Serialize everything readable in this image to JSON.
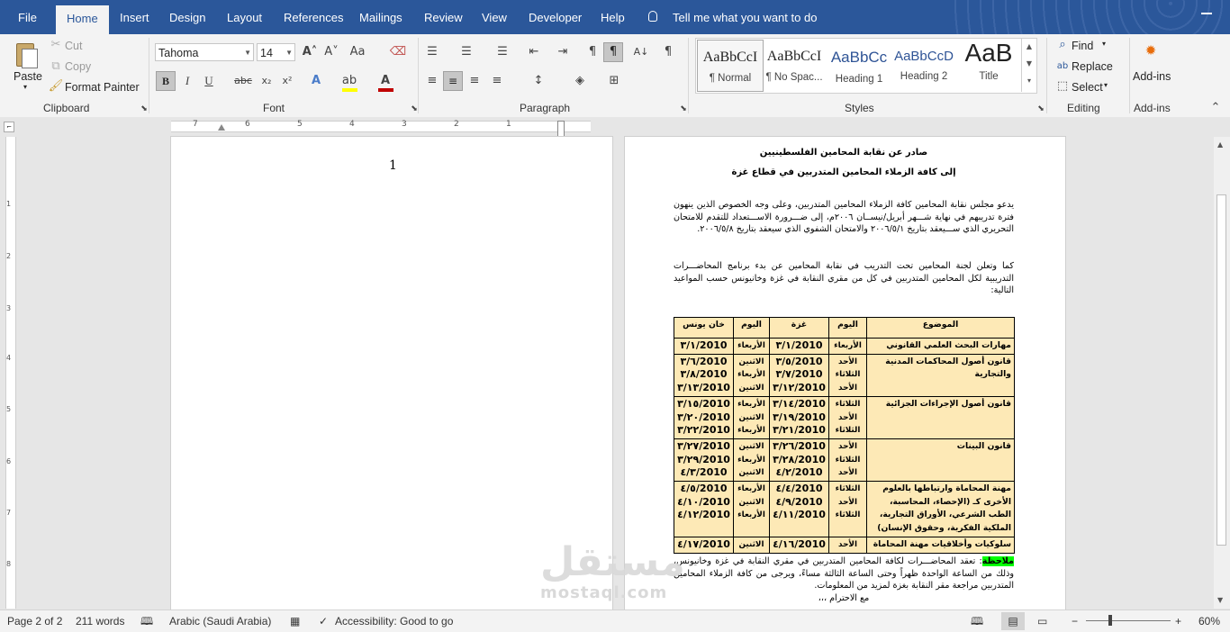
{
  "tabs": [
    "File",
    "Home",
    "Insert",
    "Design",
    "Layout",
    "References",
    "Mailings",
    "Review",
    "View",
    "Developer",
    "Help"
  ],
  "tell_me": "Tell me what you want to do",
  "clipboard": {
    "paste": "Paste",
    "cut": "Cut",
    "copy": "Copy",
    "format_painter": "Format Painter",
    "label": "Clipboard"
  },
  "font": {
    "name": "Tahoma",
    "size": "14",
    "label": "Font"
  },
  "paragraph": {
    "label": "Paragraph"
  },
  "styles": {
    "label": "Styles",
    "items": [
      {
        "preview": "AaBbCcI",
        "name": "¶ Normal"
      },
      {
        "preview": "AaBbCcI",
        "name": "¶ No Spac..."
      },
      {
        "preview": "AaBbCc",
        "name": "Heading 1"
      },
      {
        "preview": "AaBbCcD",
        "name": "Heading 2"
      },
      {
        "preview": "AaB",
        "name": "Title"
      }
    ]
  },
  "editing": {
    "find": "Find",
    "replace": "Replace",
    "select": "Select",
    "label": "Editing"
  },
  "addins": {
    "button": "Add-ins",
    "label": "Add-ins"
  },
  "ruler": {
    "h_numbers": [
      "7",
      "6",
      "5",
      "4",
      "3",
      "2",
      "1"
    ],
    "v_numbers": [
      "1",
      "2",
      "3",
      "4",
      "5",
      "6",
      "7",
      "8"
    ]
  },
  "left_page": {
    "number": "1"
  },
  "document": {
    "header1": "صادر عن نقابة المحامين الفلسطينيين",
    "header2": "إلى كافة الزملاء المحامين المتدربين في قطاع غزة",
    "para1": "يدعو مجلس نقابة المحامين كافة الزملاء المحامين المتدربين، وعلى وجه الخصوص الذين ينهون فترة تدريبهم في نهاية شـــهر أبريل/نيســان ٢٠٠٦م، إلى ضـــرورة الاســـتعداد للتقدم للامتحان التحريري الذي ســـيعقد بتاريخ ٢٠٠٦/٥/١ والامتحان الشفوي الذي سيعقد بتاريخ ٢٠٠٦/٥/٨.",
    "para2": "كما وتعلن لجنة المحامين تحت التدريب في نقابة المحامين عن بدء برنامج المحاضـــرات التدريبية لكل المحامين المتدربين في كل من مقري النقابة في غزة وخانيونس حسب المواعيد التالية:",
    "table": {
      "headers": [
        "الموضوع",
        "اليوم",
        "غزة",
        "اليوم",
        "خان يونس"
      ],
      "rows": [
        {
          "subject": "مهارات البحث العلمي القانوني",
          "day1": "الأربعاء",
          "gaza": "2010/٣/١",
          "day2": "الأربعاء",
          "khan": "2010/٣/١"
        },
        {
          "subject": "قانون أصول المحاكمات المدنية والتجارية",
          "day1": "الأحد\nالثلاثاء\nالأحد",
          "gaza": "2010/٣/٥\n2010/٣/٧\n2010/٣/١٢",
          "day2": "الاثنين\nالأربعاء\nالاثنين",
          "khan": "2010/٣/٦\n2010/٣/٨\n2010/٣/١٣"
        },
        {
          "subject": "قانون أصول الإجراءات الجزائية",
          "day1": "الثلاثاء\nالأحد\nالثلاثاء",
          "gaza": "2010/٣/١٤\n2010/٣/١٩\n2010/٣/٢١",
          "day2": "الأربعاء\nالاثنين\nالأربعاء",
          "khan": "2010/٣/١٥\n2010/٣/٢٠\n2010/٣/٢٢"
        },
        {
          "subject": "قانون البينات",
          "day1": "الأحد\nالثلاثاء\nالأحد",
          "gaza": "2010/٣/٢٦\n2010/٣/٢٨\n2010/٤/٢",
          "day2": "الاثنين\nالأربعاء\nالاثنين",
          "khan": "2010/٣/٢٧\n2010/٣/٢٩\n2010/٤/٣"
        },
        {
          "subject": "مهنة المحاماة وارتباطها بالعلوم الأخرى كـ (الإحصاء، المحاسبة، الطب الشرعي، الأوراق التجارية، الملكية الفكرية، وحقوق الإنسان)",
          "day1": "الثلاثاء\nالأحد\nالثلاثاء",
          "gaza": "2010/٤/٤\n2010/٤/٩\n2010/٤/١١",
          "day2": "الأربعاء\nالاثنين\nالأربعاء",
          "khan": "2010/٤/٥\n2010/٤/١٠\n2010/٤/١٢"
        },
        {
          "subject": "سلوكيات وأخلاقيات مهنة المحاماة",
          "day1": "الأحد",
          "gaza": "2010/٤/١٦",
          "day2": "الاثنين",
          "khan": "2010/٤/١٧"
        }
      ]
    },
    "note_label": "ملاحظة",
    "note_text": ": تعقد المحاضـــرات لكافة المحامين المتدربين في مقري النقابة في غزة وخانيونس، وذلك من الساعة الواحدة ظهراً وحتى الساعة الثالثة مساءً، ويرجى من كافة الزملاء المحامين المتدربين مراجعة مقر النقابة بغزة لمزيد من المعلومات.",
    "closing": "مع الاحترام ،،،"
  },
  "watermark": {
    "arabic": "مستقل",
    "latin": "mostaql.com"
  },
  "status": {
    "page": "Page 2 of 2",
    "words": "211 words",
    "language": "Arabic (Saudi Arabia)",
    "accessibility": "Accessibility: Good to go",
    "zoom": "60%"
  }
}
